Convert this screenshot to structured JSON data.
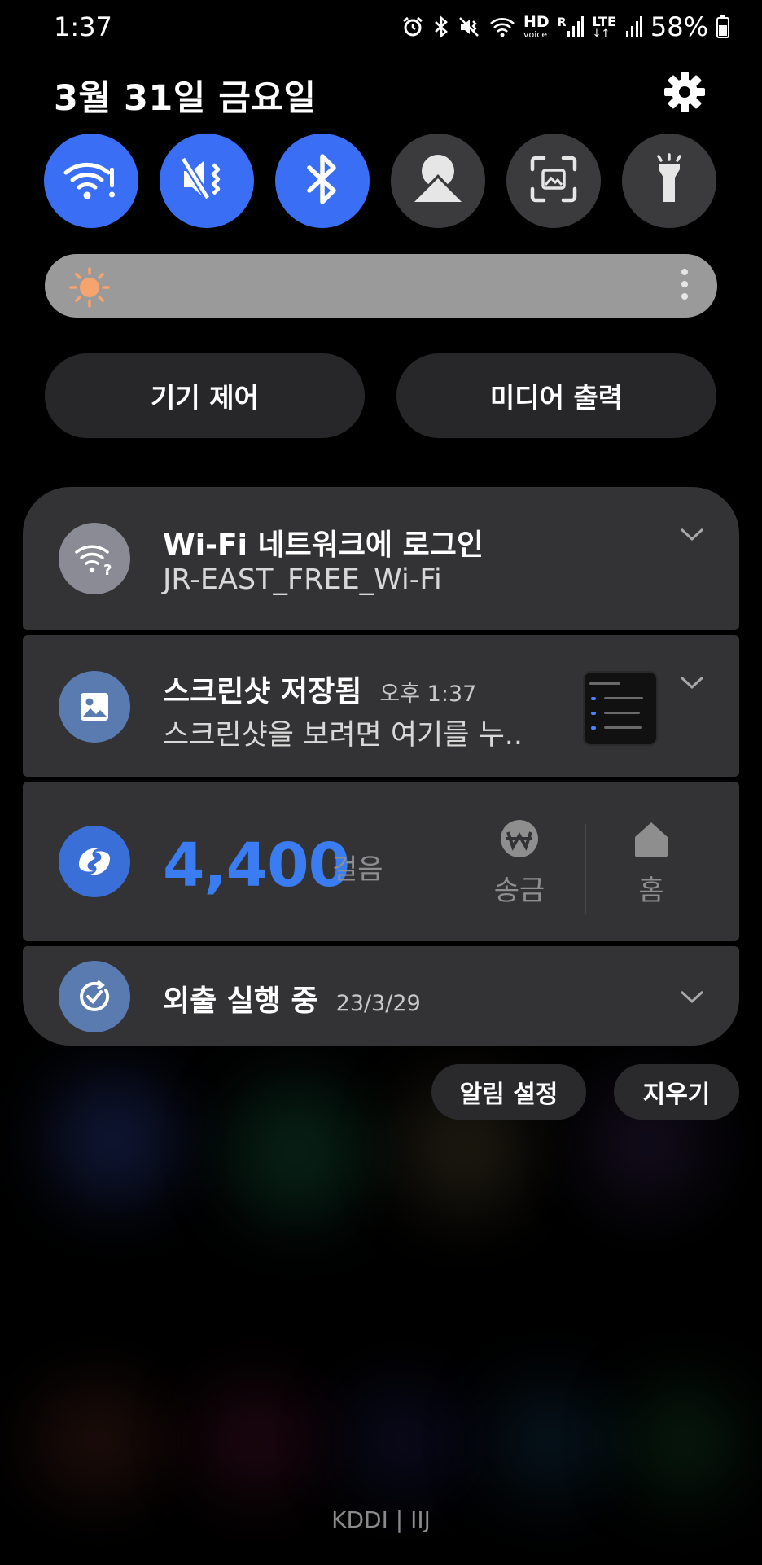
{
  "status_bar": {
    "time": "1:37",
    "network_labels": [
      "HD",
      "voice",
      "R",
      "LTE",
      "R"
    ],
    "battery_percent": "58%",
    "icons": [
      "alarm-icon",
      "bluetooth-icon",
      "vibrate-mute-icon",
      "wifi-icon",
      "signal-icon",
      "battery-icon"
    ]
  },
  "header": {
    "date": "3월 31일 금요일",
    "settings_icon": "gear-icon"
  },
  "quick_tiles": [
    {
      "name": "wifi",
      "icon": "wifi-alert-icon",
      "state": "on"
    },
    {
      "name": "mute",
      "icon": "mute-vibrate-icon",
      "state": "on"
    },
    {
      "name": "bluetooth",
      "icon": "bluetooth-icon",
      "state": "on"
    },
    {
      "name": "auto-rotate",
      "icon": "rotate-icon",
      "state": "off"
    },
    {
      "name": "screen-capture",
      "icon": "scan-icon",
      "state": "off"
    },
    {
      "name": "flashlight",
      "icon": "flashlight-icon",
      "state": "off"
    }
  ],
  "brightness": {
    "level": 0.0,
    "icon": "sun-icon"
  },
  "buttons": {
    "device_control": "기기 제어",
    "media_output": "미디어 출력"
  },
  "notifications": [
    {
      "title": "Wi-Fi 네트워크에 로그인",
      "subtitle": "JR-EAST_FREE_Wi-Fi",
      "icon": "wifi-question-icon"
    },
    {
      "title": "스크린샷 저장됨",
      "time": "오후 1:37",
      "subtitle": "스크린샷을 보려면 여기를 누..",
      "icon": "image-icon"
    },
    {
      "steps": "4,400",
      "unit": "걸음",
      "actions": [
        {
          "label": "송금",
          "icon": "won-icon"
        },
        {
          "label": "홈",
          "icon": "home-icon"
        }
      ],
      "icon": "pay-icon"
    },
    {
      "title": "외출 실행 중",
      "time": "23/3/29",
      "icon": "routine-icon"
    }
  ],
  "footer_buttons": {
    "notification_settings": "알림 설정",
    "clear": "지우기"
  },
  "carrier": "KDDI | IIJ",
  "colors": {
    "accent": "#3a6ff5",
    "steps": "#3a7cf2",
    "card": "#333335",
    "tile_off": "#3b3b3d"
  }
}
